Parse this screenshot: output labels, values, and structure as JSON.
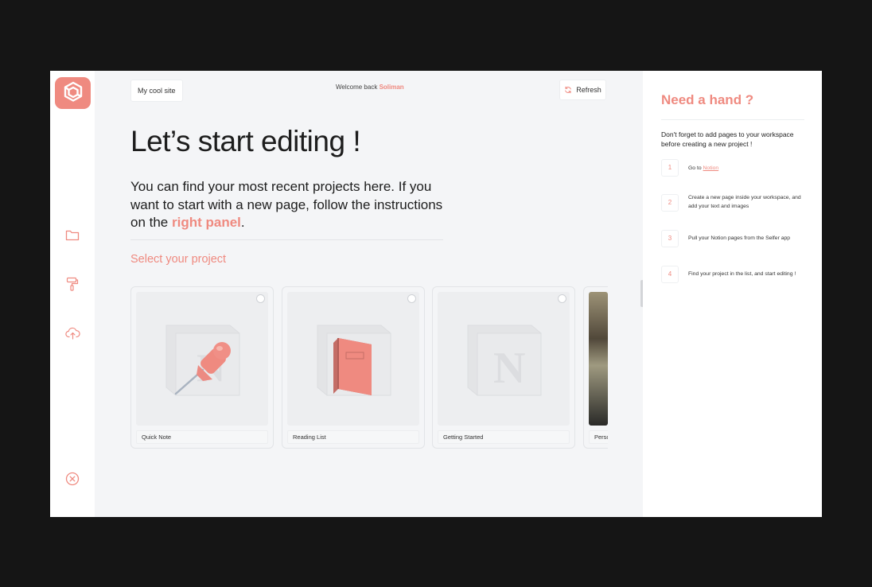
{
  "brand": {
    "accent": "#ef8a80",
    "background": "#151515",
    "main_bg": "#f4f5f7"
  },
  "sidebar": {
    "icons": [
      {
        "name": "folder-icon"
      },
      {
        "name": "paint-roller-icon"
      },
      {
        "name": "cloud-upload-icon"
      }
    ],
    "close_icon": "close-circle-icon"
  },
  "header": {
    "site_name": "My cool site",
    "welcome_prefix": "Welcome back",
    "user_name": "Soliman",
    "refresh_label": "Refresh"
  },
  "main": {
    "title": "Let’s start editing !",
    "intro_text": "You can find your most recent projects here. If you want to start with a new page, follow the instructions on the",
    "intro_link": "right panel",
    "intro_end": ".",
    "section_label": "Select your project",
    "projects": [
      {
        "title": "Quick Note",
        "icon": "pushpin-icon"
      },
      {
        "title": "Reading List",
        "icon": "book-icon"
      },
      {
        "title": "Getting Started",
        "icon": "notion-icon"
      },
      {
        "title": "Perso",
        "icon": "photo-thumbnail"
      }
    ]
  },
  "help_panel": {
    "title": "Need a hand ?",
    "note": "Don't forget to add pages to your workspace before creating a new project !",
    "steps": [
      {
        "number": "1",
        "text": "Go to",
        "link": "Notion"
      },
      {
        "number": "2",
        "text": "Create a new page inside your workspace, and add your text and images"
      },
      {
        "number": "3",
        "text": "Pull your Notion pages from the Selfer app"
      },
      {
        "number": "4",
        "text": "Find your project in the list, and start editing !"
      }
    ]
  }
}
